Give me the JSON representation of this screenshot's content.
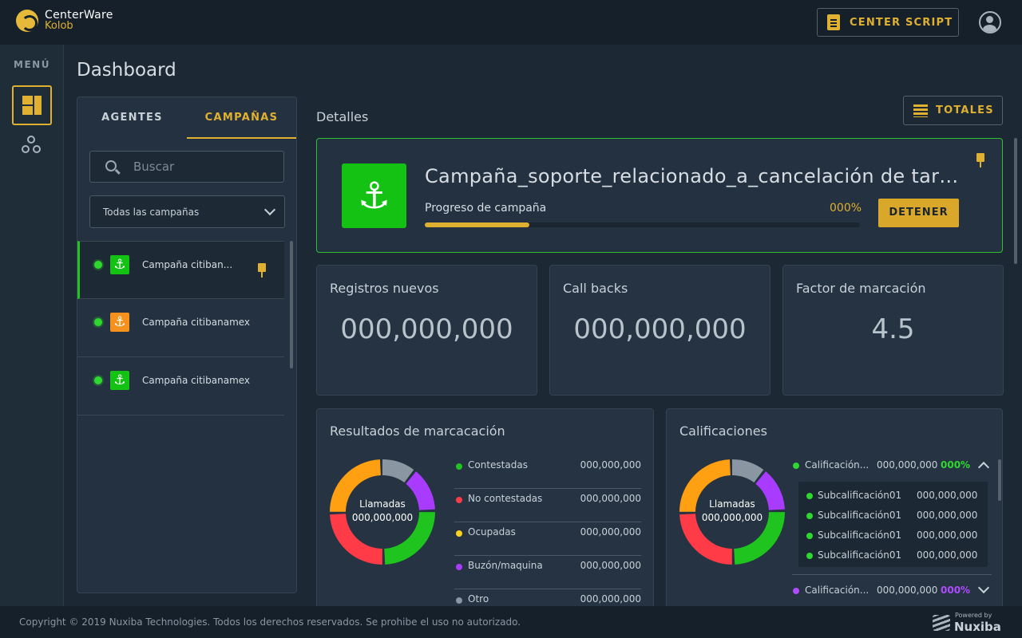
{
  "header": {
    "logo_line1": "CenterWare",
    "logo_line2": "Kolob",
    "center_script_label": "CENTER SCRIPT"
  },
  "sidebar": {
    "menu_label": "MENÚ"
  },
  "page": {
    "title": "Dashboard"
  },
  "left_panel": {
    "tabs": [
      {
        "label": "AGENTES",
        "active": false
      },
      {
        "label": "CAMPAÑAS",
        "active": true
      }
    ],
    "search": {
      "placeholder": "Buscar",
      "value": ""
    },
    "filter": {
      "selected": "Todas las campañas"
    },
    "campaigns": [
      {
        "name": "Campaña citiban...",
        "status_color": "#2fd82f",
        "badge_color": "#14c214",
        "icon": "anchor-icon",
        "pinned": true,
        "active": true
      },
      {
        "name": "Campaña citibanamex",
        "status_color": "#2fd82f",
        "badge_color": "#f5921e",
        "icon": "anchor-icon",
        "pinned": false,
        "active": false
      },
      {
        "name": "Campaña citibanamex",
        "status_color": "#2fd82f",
        "badge_color": "#14c214",
        "icon": "anchor-icon",
        "pinned": false,
        "active": false
      }
    ]
  },
  "details": {
    "label": "Detalles",
    "totales_label": "TOTALES",
    "campaign": {
      "title": "Campaña_soporte_relacionado_a_cancelación de tarjetas",
      "progress_label": "Progreso de campaña",
      "progress_text": "000%",
      "progress_fraction": 0.24,
      "stop_label": "DETENER",
      "accent_color": "#2fbf2f"
    },
    "stats": [
      {
        "label": "Registros nuevos",
        "value": "000,000,000"
      },
      {
        "label": "Call backs",
        "value": "000,000,000"
      },
      {
        "label": "Factor de marcación",
        "value": "4.5"
      }
    ],
    "resultados": {
      "title": "Resultados de marcacación",
      "center_label": "Llamadas",
      "center_value": "000,000,000",
      "legend": [
        {
          "name": "Contestadas",
          "value": "000,000,000",
          "color": "#1fc41f"
        },
        {
          "name": "No contestadas",
          "value": "000,000,000",
          "color": "#ff3b47"
        },
        {
          "name": "Ocupadas",
          "value": "000,000,000",
          "color": "#ffd21f"
        },
        {
          "name": "Buzón/maquina",
          "value": "000,000,000",
          "color": "#a93bff"
        },
        {
          "name": "Otro",
          "value": "000,000,000",
          "color": "#8a96a1"
        }
      ]
    },
    "calificaciones": {
      "title": "Calificaciones",
      "center_label": "Llamadas",
      "center_value": "000,000,000",
      "groups": [
        {
          "name": "Calificación...",
          "value": "000,000,000",
          "pct": "000%",
          "color": "#2fd82f",
          "expanded": true
        },
        {
          "name": "Calificación...",
          "value": "000,000,000",
          "pct": "000%",
          "color": "#b04bff",
          "expanded": false
        }
      ],
      "subitems": [
        {
          "name": "Subcalificación01",
          "value": "000,000,000"
        },
        {
          "name": "Subcalificación01",
          "value": "000,000,000"
        },
        {
          "name": "Subcalificación01",
          "value": "000,000,000"
        },
        {
          "name": "Subcalificación01",
          "value": "000,000,000"
        }
      ]
    }
  },
  "donut_segments": [
    {
      "color": "#8a96a1",
      "fraction": 0.11
    },
    {
      "color": "#a93bff",
      "fraction": 0.14
    },
    {
      "color": "#1fc41f",
      "fraction": 0.25
    },
    {
      "color": "#ff3b47",
      "fraction": 0.25
    },
    {
      "color": "#ff9f12",
      "fraction": 0.25
    }
  ],
  "footer": {
    "copyright": "Copyright © 2019 Nuxiba Technologies. Todos los derechos reservados. Se prohibe el uso no autorizado.",
    "powered_by": "Powered by",
    "brand": "Nuxiba"
  }
}
